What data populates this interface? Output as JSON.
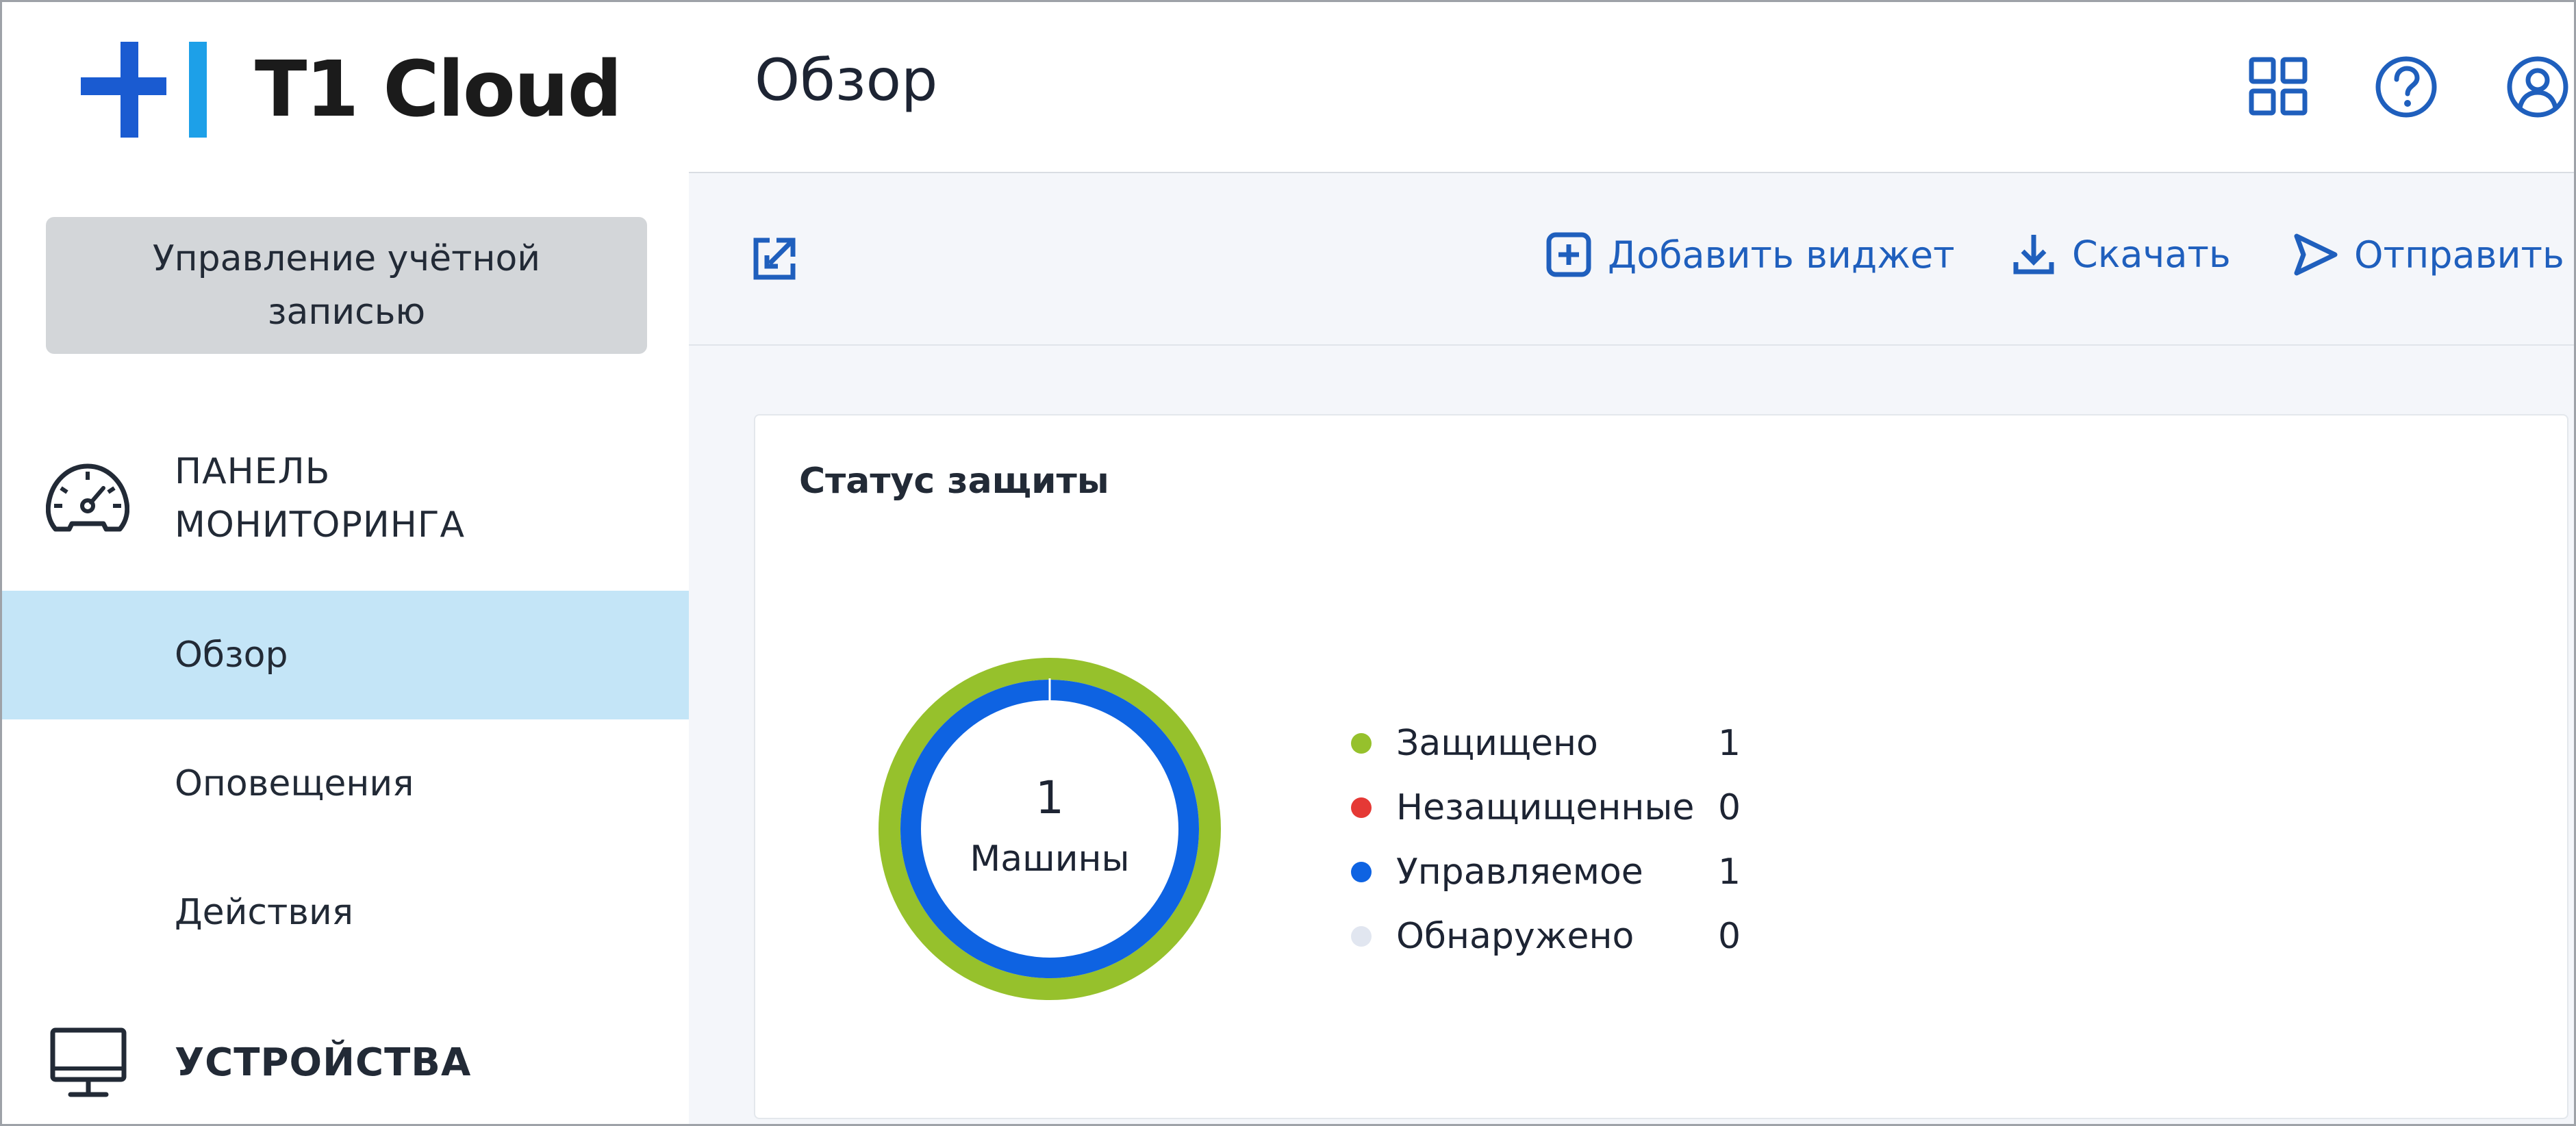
{
  "brand": {
    "name": "T1 Cloud",
    "logo_colors": [
      "#1a5bd1",
      "#1da0e8"
    ]
  },
  "sidebar": {
    "account_button": "Управление учётной записью",
    "sections": [
      {
        "icon": "speedometer-icon",
        "label": "ПАНЕЛЬ МОНИТОРИНГА"
      },
      {
        "icon": "monitor-icon",
        "label": "УСТРОЙСТВА"
      }
    ],
    "items": [
      {
        "label": "Обзор",
        "active": true
      },
      {
        "label": "Оповещения",
        "active": false
      },
      {
        "label": "Действия",
        "active": false
      }
    ]
  },
  "header": {
    "title": "Обзор",
    "icons": [
      "apps-grid-icon",
      "help-icon",
      "user-icon"
    ]
  },
  "toolbar": {
    "expand_icon": "expand-icon",
    "add_widget": "Добавить виджет",
    "download": "Скачать",
    "send": "Отправить"
  },
  "widget": {
    "title": "Статус защиты",
    "total": "1",
    "total_label": "Машины",
    "legend": [
      {
        "label": "Защищено",
        "value": "1",
        "color": "#96c12c"
      },
      {
        "label": "Незащищенные",
        "value": "0",
        "color": "#e53935"
      },
      {
        "label": "Управляемое",
        "value": "1",
        "color": "#0e63e2"
      },
      {
        "label": "Обнаружено",
        "value": "0",
        "color": "#e1e6f0"
      }
    ]
  },
  "colors": {
    "accent": "#1f5fbd",
    "active_item_bg": "#c4e5f7",
    "account_button_bg": "#d3d6d9",
    "main_bg": "#f4f6fa"
  }
}
